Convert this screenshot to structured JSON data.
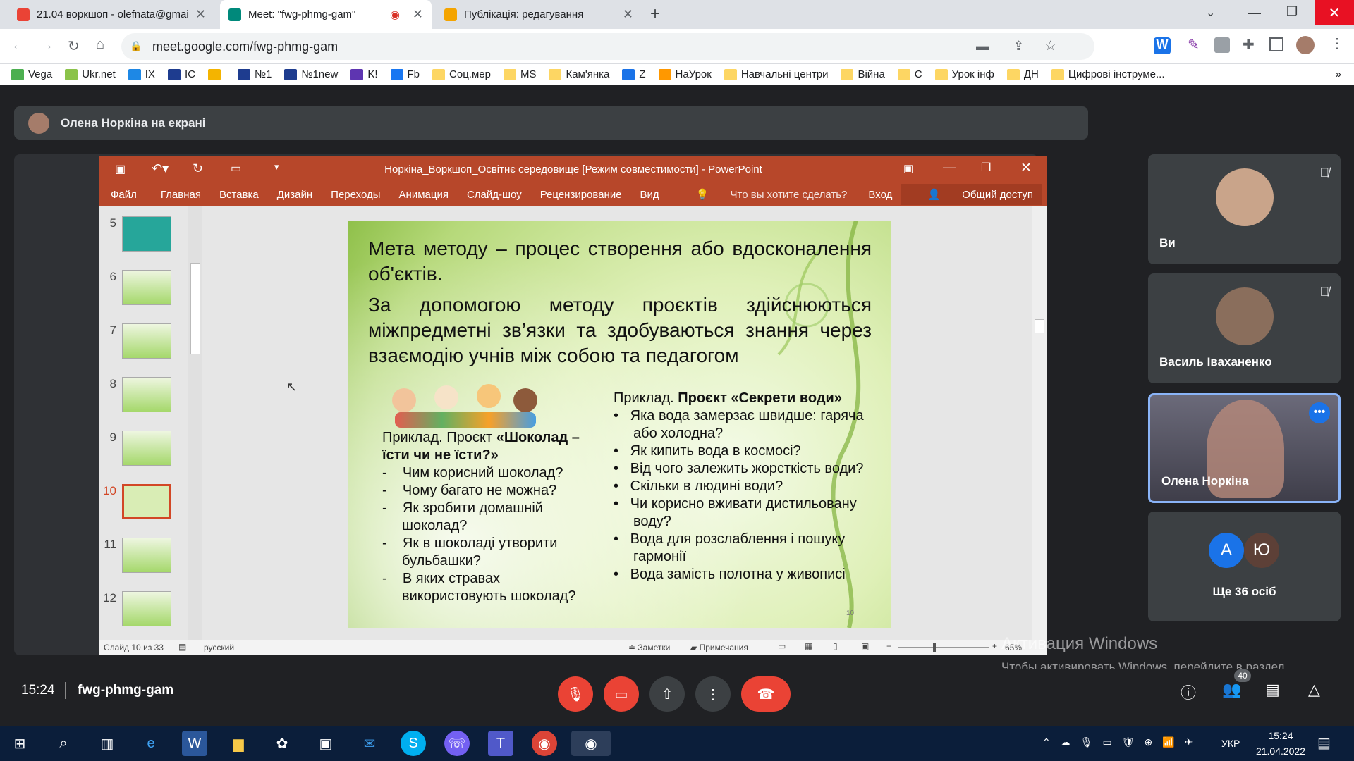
{
  "browser": {
    "tabs": [
      {
        "title": "21.04 воркшоп - olefnata@gmai",
        "color": "#ea4335",
        "icon": "gmail-icon"
      },
      {
        "title": "Meet: \"fwg-phmg-gam\"",
        "color": "#00897b",
        "icon": "meet-icon"
      },
      {
        "title": "Публікація: редагування",
        "color": "#f4a400",
        "icon": "blogger-icon"
      }
    ],
    "new_tab": "+",
    "url": "meet.google.com/fwg-phmg-gam",
    "bookmarks": [
      "Vega",
      "Ukr.net",
      "IX",
      "IC",
      "",
      "№1",
      "№1new",
      "K!",
      "Fb",
      "Соц.мер",
      "MS",
      "Кам'янка",
      "Z",
      "НаУрок",
      "Навчальні центри",
      "Війна",
      "С",
      "Урок інф",
      "ДН",
      "Цифрові інструме..."
    ],
    "more": "»"
  },
  "meet": {
    "presenting": "Олена Норкіна на екрані",
    "participants": [
      {
        "name": "Ви",
        "muted": true
      },
      {
        "name": "Василь Іваханенко",
        "muted": true
      },
      {
        "name": "Олена Норкіна",
        "muted": false,
        "active": true
      }
    ],
    "others": {
      "a": "А",
      "b": "Ю",
      "label": "Ще 36 осіб"
    },
    "time": "15:24",
    "meeting_code": "fwg-phmg-gam",
    "people_count": "40",
    "activate": {
      "title": "Активация Windows",
      "sub": "Чтобы активировать Windows, перейдите в раздел \"Параметры\"."
    }
  },
  "ppt": {
    "title": "Норкіна_Воркшоп_Освітнє середовище [Режим совместимости] - PowerPoint",
    "menu": [
      "Файл",
      "Главная",
      "Вставка",
      "Дизайн",
      "Переходы",
      "Анимация",
      "Слайд-шоу",
      "Рецензирование",
      "Вид",
      "Что вы хотите сделать?"
    ],
    "signin": "Вход",
    "share": "Общий доступ",
    "thumb_nums": [
      "5",
      "6",
      "7",
      "8",
      "9",
      "10",
      "11",
      "12"
    ],
    "status": {
      "slide": "Слайд 10 из 33",
      "lang": "русский",
      "notes": "Заметки",
      "comments": "Примечания",
      "zoom": "65%"
    },
    "slide": {
      "p1": "Мета методу – процес створення або вдосконалення об'єктів.",
      "p2": "За допомогою методу проєктів здійснюються міжпредметні зв’язки та здобуваються знання через взаємодію учнів між собою та педагогом",
      "left_title_a": "Приклад. Проєкт ",
      "left_title_b": "«Шоколад – їсти чи не їсти?»",
      "left_items": [
        "Чим корисний шоколад?",
        "Чому багато не можна?",
        "Як зробити домашній шоколад?",
        "Як в шоколаді утворити бульбашки?",
        "В яких стравах використовують шоколад?"
      ],
      "right_title_a": "Приклад. ",
      "right_title_b": "Проєкт «Секрети води»",
      "right_items": [
        "Яка вода замерзає швидше: гаряча або холодна?",
        "Як кипить вода в космосі?",
        "Від чого залежить жорсткість води?",
        "Скільки в людині води?",
        "Чи корисно вживати дистильовану  воду?",
        "Вода для розслаблення і пошуку гармонії",
        "Вода замість полотна у живописі"
      ],
      "page_num": "10"
    }
  },
  "taskbar": {
    "lang": "УКР",
    "time": "15:24",
    "date": "21.04.2022"
  }
}
